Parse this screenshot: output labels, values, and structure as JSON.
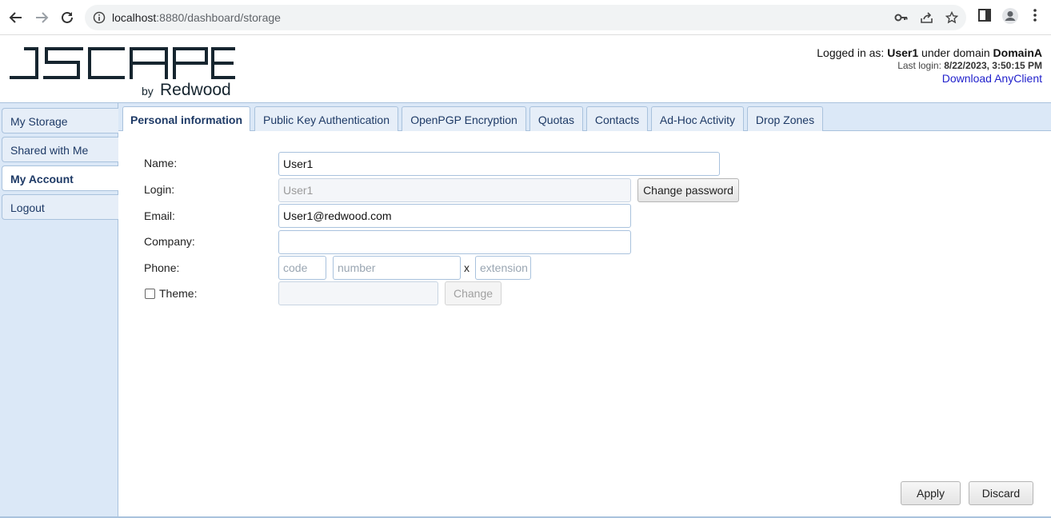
{
  "browser": {
    "url_host": "localhost",
    "url_path": ":8880/dashboard/storage"
  },
  "header": {
    "logo_text": "JSCAPE",
    "logo_sub_by": "by",
    "logo_sub_brand": "Redwood",
    "logged_in_prefix": "Logged in as: ",
    "user": "User1",
    "under_domain": " under domain ",
    "domain": "DomainA",
    "last_login_prefix": "Last login: ",
    "last_login_value": "8/22/2023, 3:50:15 PM",
    "download_label": "Download AnyClient"
  },
  "sidebar": {
    "items": [
      {
        "label": "My Storage"
      },
      {
        "label": "Shared with Me"
      },
      {
        "label": "My Account"
      },
      {
        "label": "Logout"
      }
    ]
  },
  "tabs": [
    {
      "label": "Personal information"
    },
    {
      "label": "Public Key Authentication"
    },
    {
      "label": "OpenPGP Encryption"
    },
    {
      "label": "Quotas"
    },
    {
      "label": "Contacts"
    },
    {
      "label": "Ad-Hoc Activity"
    },
    {
      "label": "Drop Zones"
    }
  ],
  "form": {
    "name_label": "Name:",
    "name_value": "User1",
    "login_label": "Login:",
    "login_value": "User1",
    "change_password_label": "Change password",
    "email_label": "Email:",
    "email_value": "User1@redwood.com",
    "company_label": "Company:",
    "company_value": "",
    "phone_label": "Phone:",
    "phone_code_placeholder": "code",
    "phone_number_placeholder": "number",
    "phone_x": "x",
    "phone_ext_placeholder": "extension",
    "theme_label": "Theme:",
    "theme_change_label": "Change"
  },
  "actions": {
    "apply_label": "Apply",
    "discard_label": "Discard"
  }
}
